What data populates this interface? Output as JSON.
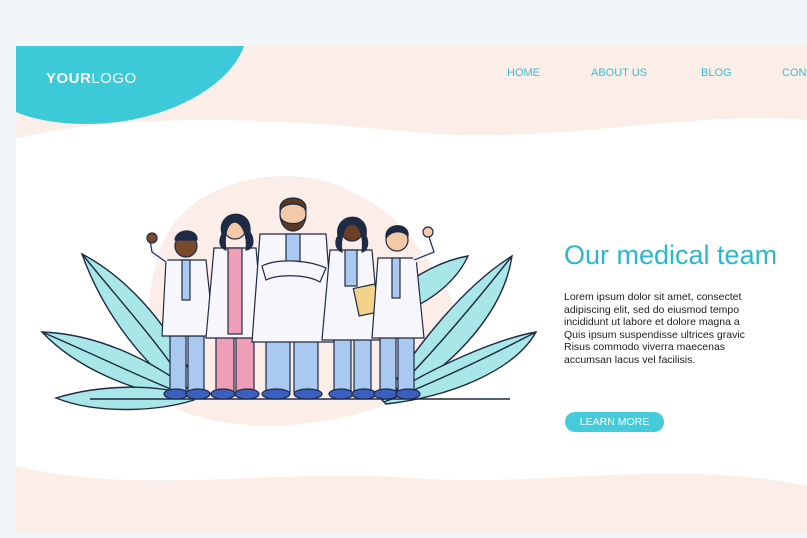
{
  "header": {
    "logo_bold": "YOUR",
    "logo_light": "LOGO",
    "nav": [
      {
        "label": "HOME"
      },
      {
        "label": "ABOUT US"
      },
      {
        "label": "BLOG"
      },
      {
        "label": "CON"
      }
    ]
  },
  "hero": {
    "title": "Our medical team",
    "body": "Lorem ipsum dolor sit amet, consectet\nadipiscing elit, sed do eiusmod tempo\nincididunt ut labore et dolore magna a\nQuis ipsum suspendisse ultrices gravic\nRisus commodo viverra maecenas\naccumsan lacus vel facilisis.",
    "button_label": "LEARN MORE"
  },
  "colors": {
    "accent": "#35bfd3",
    "logo_bg": "#3cc9d8",
    "page_bg": "#fbeee8",
    "band_bg": "#ffffff",
    "button_bg": "#45cbd9",
    "leaf": "#a8e6e8",
    "coat": "#f7f7fb",
    "scrub_pink": "#ef9eb8",
    "scrub_blue": "#a9c9f0",
    "shoe": "#3b5fbf"
  },
  "illustration": {
    "subject": "five-doctors-group",
    "icons": [
      "leaf-icon",
      "doctor-icon",
      "clipboard-icon"
    ]
  }
}
